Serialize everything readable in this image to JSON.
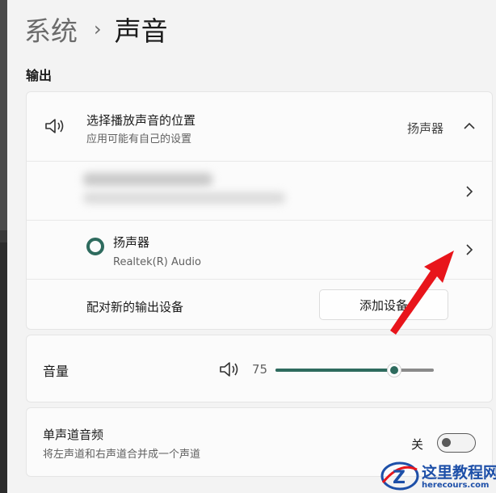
{
  "breadcrumb": {
    "parent": "系统",
    "separator": "›",
    "current": "声音"
  },
  "output": {
    "heading": "输出",
    "choose_location": {
      "title": "选择播放声音的位置",
      "subtitle": "应用可能有自己的设置",
      "current_value": "扬声器",
      "icon": "speaker-icon",
      "expanded": true
    },
    "devices": [
      {
        "name": "",
        "detail": "",
        "selected": false,
        "redacted": true
      },
      {
        "name": "扬声器",
        "detail": "Realtek(R) Audio",
        "selected": true,
        "redacted": false
      }
    ],
    "pair_new": {
      "label": "配对新的输出设备",
      "button_label": "添加设备"
    }
  },
  "volume": {
    "label": "音量",
    "value": "75",
    "level_percent": 75,
    "icon": "speaker-icon"
  },
  "mono_audio": {
    "title": "单声道音频",
    "subtitle": "将左声道和右声道合并成一个声道",
    "state_label": "关",
    "on": false
  },
  "annotation": {
    "arrow_color": "#e8151b",
    "points_to": "speaker-device-chevron"
  },
  "watermark": {
    "line1": "这里教程网",
    "line2": "herecours.com",
    "logo_letter": "Z"
  },
  "colors": {
    "accent": "#2e6b5e",
    "background": "#f3f3f3",
    "card": "#fbfbfb",
    "arrow": "#e8151b",
    "watermark": "#1d4fa8"
  }
}
